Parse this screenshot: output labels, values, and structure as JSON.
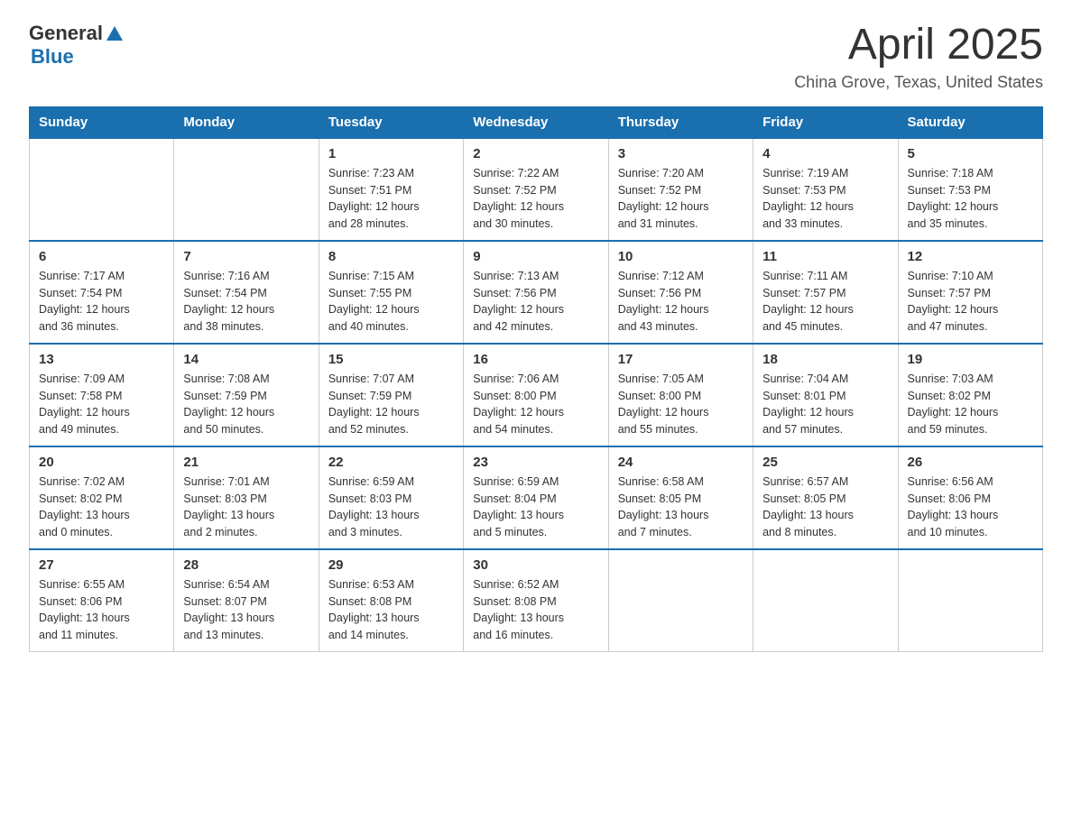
{
  "header": {
    "logo_general": "General",
    "logo_blue": "Blue",
    "title": "April 2025",
    "location": "China Grove, Texas, United States"
  },
  "days_of_week": [
    "Sunday",
    "Monday",
    "Tuesday",
    "Wednesday",
    "Thursday",
    "Friday",
    "Saturday"
  ],
  "weeks": [
    [
      {
        "day": "",
        "info": ""
      },
      {
        "day": "",
        "info": ""
      },
      {
        "day": "1",
        "info": "Sunrise: 7:23 AM\nSunset: 7:51 PM\nDaylight: 12 hours\nand 28 minutes."
      },
      {
        "day": "2",
        "info": "Sunrise: 7:22 AM\nSunset: 7:52 PM\nDaylight: 12 hours\nand 30 minutes."
      },
      {
        "day": "3",
        "info": "Sunrise: 7:20 AM\nSunset: 7:52 PM\nDaylight: 12 hours\nand 31 minutes."
      },
      {
        "day": "4",
        "info": "Sunrise: 7:19 AM\nSunset: 7:53 PM\nDaylight: 12 hours\nand 33 minutes."
      },
      {
        "day": "5",
        "info": "Sunrise: 7:18 AM\nSunset: 7:53 PM\nDaylight: 12 hours\nand 35 minutes."
      }
    ],
    [
      {
        "day": "6",
        "info": "Sunrise: 7:17 AM\nSunset: 7:54 PM\nDaylight: 12 hours\nand 36 minutes."
      },
      {
        "day": "7",
        "info": "Sunrise: 7:16 AM\nSunset: 7:54 PM\nDaylight: 12 hours\nand 38 minutes."
      },
      {
        "day": "8",
        "info": "Sunrise: 7:15 AM\nSunset: 7:55 PM\nDaylight: 12 hours\nand 40 minutes."
      },
      {
        "day": "9",
        "info": "Sunrise: 7:13 AM\nSunset: 7:56 PM\nDaylight: 12 hours\nand 42 minutes."
      },
      {
        "day": "10",
        "info": "Sunrise: 7:12 AM\nSunset: 7:56 PM\nDaylight: 12 hours\nand 43 minutes."
      },
      {
        "day": "11",
        "info": "Sunrise: 7:11 AM\nSunset: 7:57 PM\nDaylight: 12 hours\nand 45 minutes."
      },
      {
        "day": "12",
        "info": "Sunrise: 7:10 AM\nSunset: 7:57 PM\nDaylight: 12 hours\nand 47 minutes."
      }
    ],
    [
      {
        "day": "13",
        "info": "Sunrise: 7:09 AM\nSunset: 7:58 PM\nDaylight: 12 hours\nand 49 minutes."
      },
      {
        "day": "14",
        "info": "Sunrise: 7:08 AM\nSunset: 7:59 PM\nDaylight: 12 hours\nand 50 minutes."
      },
      {
        "day": "15",
        "info": "Sunrise: 7:07 AM\nSunset: 7:59 PM\nDaylight: 12 hours\nand 52 minutes."
      },
      {
        "day": "16",
        "info": "Sunrise: 7:06 AM\nSunset: 8:00 PM\nDaylight: 12 hours\nand 54 minutes."
      },
      {
        "day": "17",
        "info": "Sunrise: 7:05 AM\nSunset: 8:00 PM\nDaylight: 12 hours\nand 55 minutes."
      },
      {
        "day": "18",
        "info": "Sunrise: 7:04 AM\nSunset: 8:01 PM\nDaylight: 12 hours\nand 57 minutes."
      },
      {
        "day": "19",
        "info": "Sunrise: 7:03 AM\nSunset: 8:02 PM\nDaylight: 12 hours\nand 59 minutes."
      }
    ],
    [
      {
        "day": "20",
        "info": "Sunrise: 7:02 AM\nSunset: 8:02 PM\nDaylight: 13 hours\nand 0 minutes."
      },
      {
        "day": "21",
        "info": "Sunrise: 7:01 AM\nSunset: 8:03 PM\nDaylight: 13 hours\nand 2 minutes."
      },
      {
        "day": "22",
        "info": "Sunrise: 6:59 AM\nSunset: 8:03 PM\nDaylight: 13 hours\nand 3 minutes."
      },
      {
        "day": "23",
        "info": "Sunrise: 6:59 AM\nSunset: 8:04 PM\nDaylight: 13 hours\nand 5 minutes."
      },
      {
        "day": "24",
        "info": "Sunrise: 6:58 AM\nSunset: 8:05 PM\nDaylight: 13 hours\nand 7 minutes."
      },
      {
        "day": "25",
        "info": "Sunrise: 6:57 AM\nSunset: 8:05 PM\nDaylight: 13 hours\nand 8 minutes."
      },
      {
        "day": "26",
        "info": "Sunrise: 6:56 AM\nSunset: 8:06 PM\nDaylight: 13 hours\nand 10 minutes."
      }
    ],
    [
      {
        "day": "27",
        "info": "Sunrise: 6:55 AM\nSunset: 8:06 PM\nDaylight: 13 hours\nand 11 minutes."
      },
      {
        "day": "28",
        "info": "Sunrise: 6:54 AM\nSunset: 8:07 PM\nDaylight: 13 hours\nand 13 minutes."
      },
      {
        "day": "29",
        "info": "Sunrise: 6:53 AM\nSunset: 8:08 PM\nDaylight: 13 hours\nand 14 minutes."
      },
      {
        "day": "30",
        "info": "Sunrise: 6:52 AM\nSunset: 8:08 PM\nDaylight: 13 hours\nand 16 minutes."
      },
      {
        "day": "",
        "info": ""
      },
      {
        "day": "",
        "info": ""
      },
      {
        "day": "",
        "info": ""
      }
    ]
  ]
}
